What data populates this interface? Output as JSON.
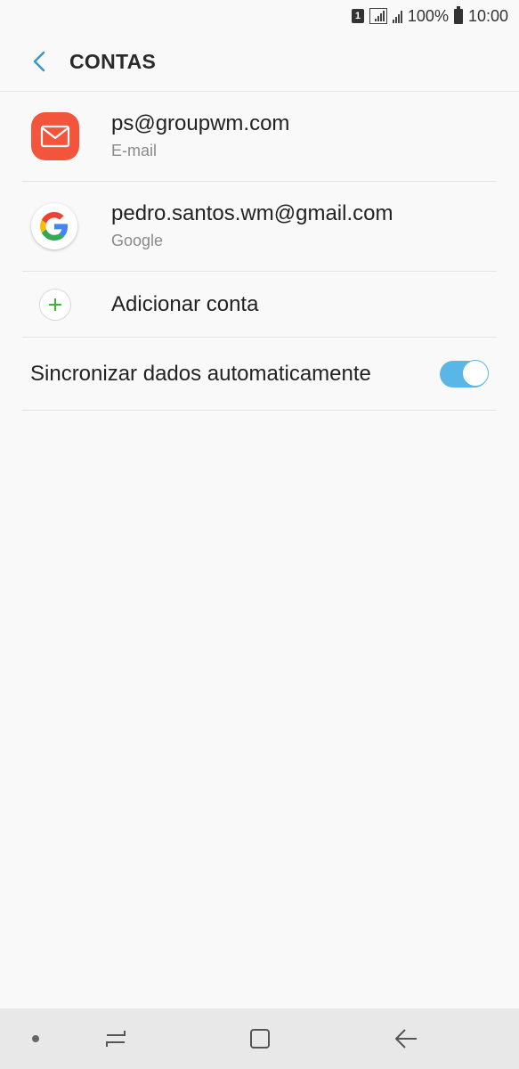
{
  "status_bar": {
    "sim_label": "1",
    "battery_text": "100%",
    "time": "10:00"
  },
  "header": {
    "back_icon": "chevron-left-icon",
    "title": "CONTAS"
  },
  "accounts": [
    {
      "address": "ps@groupwm.com",
      "type": "E-mail",
      "icon": "email-app-icon",
      "icon_color": "#f2553b"
    },
    {
      "address": "pedro.santos.wm@gmail.com",
      "type": "Google",
      "icon": "google-icon"
    }
  ],
  "add_account": {
    "label": "Adicionar conta",
    "icon": "plus-icon",
    "icon_color": "#3cb43c"
  },
  "sync": {
    "label": "Sincronizar dados automaticamente",
    "enabled": true,
    "accent_color": "#5ab6e6"
  },
  "nav_bar": {
    "buttons": [
      "dot-icon",
      "recent-apps-icon",
      "home-icon",
      "back-arrow-icon"
    ]
  }
}
